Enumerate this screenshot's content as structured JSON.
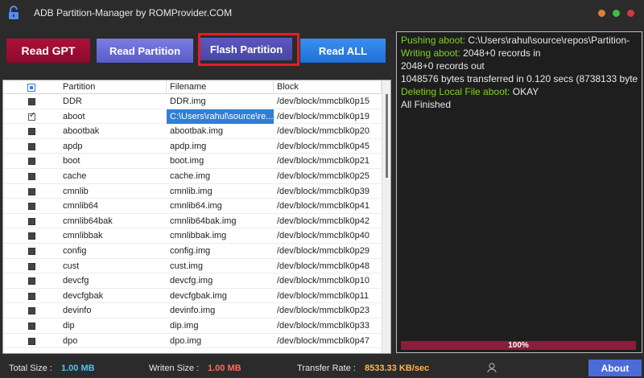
{
  "window": {
    "title": "ADB Partition-Manager by ROMProvider.COM",
    "control_colors": [
      "#e07b39",
      "#3fbf3f",
      "#d33a3a"
    ]
  },
  "toolbar": {
    "read_gpt": "Read GPT",
    "read_partition": "Read Partition",
    "flash_partition": "Flash  Partition",
    "read_all": "Read ALL"
  },
  "table": {
    "columns": [
      "Partition",
      "Filename",
      "Block"
    ],
    "rows": [
      {
        "checked": false,
        "partition": "DDR",
        "filename": "DDR.img",
        "block": "/dev/block/mmcblk0p15"
      },
      {
        "checked": true,
        "partition": "aboot",
        "filename": "C:\\Users\\rahul\\source\\re...",
        "block": "/dev/block/mmcblk0p19"
      },
      {
        "checked": false,
        "partition": "abootbak",
        "filename": "abootbak.img",
        "block": "/dev/block/mmcblk0p20"
      },
      {
        "checked": false,
        "partition": "apdp",
        "filename": "apdp.img",
        "block": "/dev/block/mmcblk0p45"
      },
      {
        "checked": false,
        "partition": "boot",
        "filename": "boot.img",
        "block": "/dev/block/mmcblk0p21"
      },
      {
        "checked": false,
        "partition": "cache",
        "filename": "cache.img",
        "block": "/dev/block/mmcblk0p25"
      },
      {
        "checked": false,
        "partition": "cmnlib",
        "filename": "cmnlib.img",
        "block": "/dev/block/mmcblk0p39"
      },
      {
        "checked": false,
        "partition": "cmnlib64",
        "filename": "cmnlib64.img",
        "block": "/dev/block/mmcblk0p41"
      },
      {
        "checked": false,
        "partition": "cmnlib64bak",
        "filename": "cmnlib64bak.img",
        "block": "/dev/block/mmcblk0p42"
      },
      {
        "checked": false,
        "partition": "cmnlibbak",
        "filename": "cmnlibbak.img",
        "block": "/dev/block/mmcblk0p40"
      },
      {
        "checked": false,
        "partition": "config",
        "filename": "config.img",
        "block": "/dev/block/mmcblk0p29"
      },
      {
        "checked": false,
        "partition": "cust",
        "filename": "cust.img",
        "block": "/dev/block/mmcblk0p48"
      },
      {
        "checked": false,
        "partition": "devcfg",
        "filename": "devcfg.img",
        "block": "/dev/block/mmcblk0p10"
      },
      {
        "checked": false,
        "partition": "devcfgbak",
        "filename": "devcfgbak.img",
        "block": "/dev/block/mmcblk0p11"
      },
      {
        "checked": false,
        "partition": "devinfo",
        "filename": "devinfo.img",
        "block": "/dev/block/mmcblk0p23"
      },
      {
        "checked": false,
        "partition": "dip",
        "filename": "dip.img",
        "block": "/dev/block/mmcblk0p33"
      },
      {
        "checked": false,
        "partition": "dpo",
        "filename": "dpo.img",
        "block": "/dev/block/mmcblk0p47"
      }
    ]
  },
  "log": {
    "lines": [
      {
        "label": "Pushing aboot:",
        "text": " C:\\Users\\rahul\\source\\repos\\Partition-"
      },
      {
        "label": "Writing aboot:",
        "text": " 2048+0 records in"
      },
      {
        "label": "",
        "text": "2048+0 records out"
      },
      {
        "label": "",
        "text": "1048576 bytes transferred in 0.120 secs (8738133 byte"
      },
      {
        "label": "Deleting Local File aboot:",
        "text": " OKAY"
      },
      {
        "label": "",
        "text": "All Finished"
      }
    ],
    "progress_label": "100%",
    "progress_value": 1.0
  },
  "status": {
    "total_size_label": "Total Size :",
    "total_size_value": "1.00 MB",
    "written_size_label": "Writen Size :",
    "written_size_value": "1.00 MB",
    "transfer_rate_label": "Transfer Rate :",
    "transfer_rate_value": "8533.33 KB/sec",
    "about": "About"
  },
  "colors": {
    "green_text": "#7ed321",
    "total_size_color": "#4fc3f7",
    "written_size_color": "#ff6b5b",
    "rate_color": "#ffb74d"
  }
}
